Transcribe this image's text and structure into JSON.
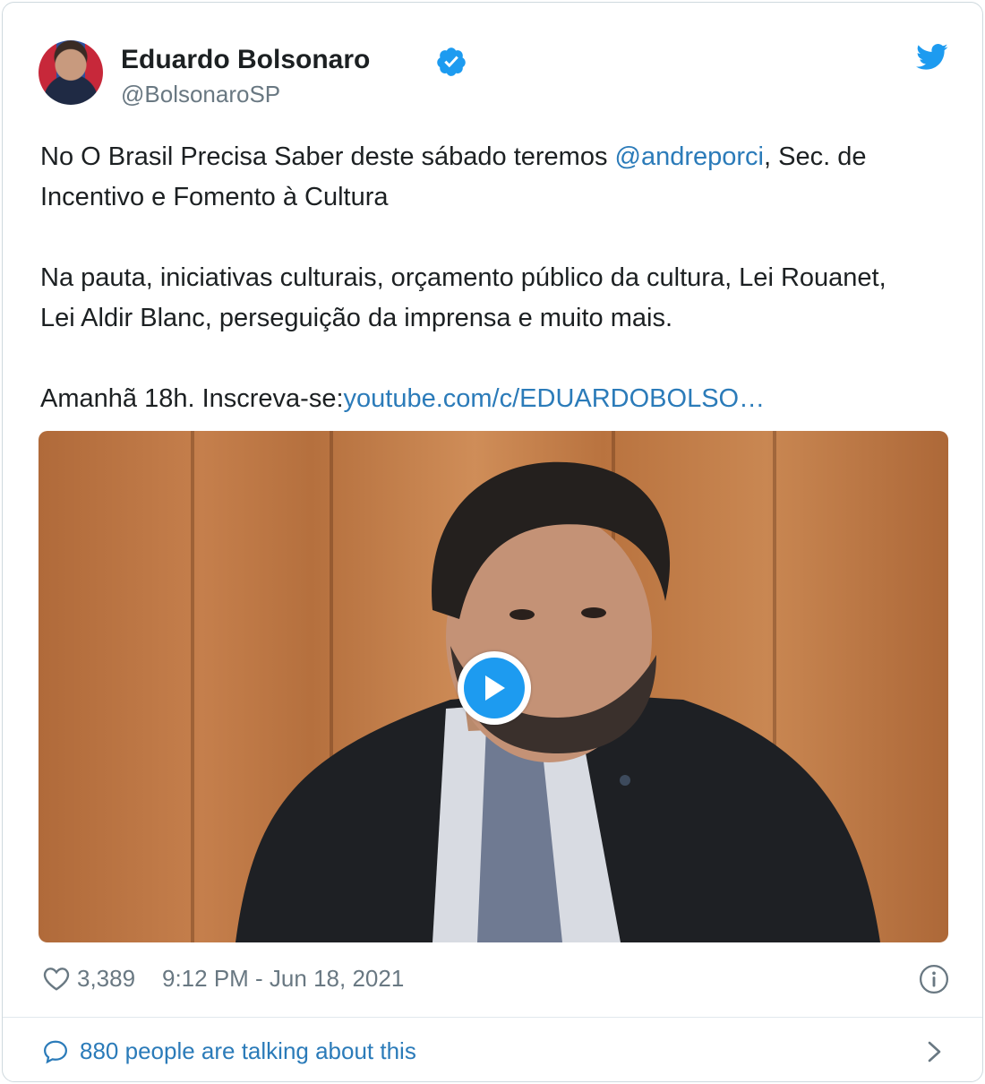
{
  "author": {
    "name": "Eduardo Bolsonaro",
    "handle": "@BolsonaroSP"
  },
  "tweet": {
    "p1_before": "No O Brasil Precisa Saber deste sábado teremos ",
    "p1_mention": "@andreporci",
    "p1_after": ", Sec. de",
    "p1_line2": "Incentivo e Fomento à Cultura",
    "p2_line1": "Na pauta, iniciativas culturais, orçamento público da cultura, Lei Rouanet,",
    "p2_line2": "Lei Aldir Blanc, perseguição da imprensa e muito mais.",
    "p3_text": "Amanhã 18h. Inscreva-se:",
    "p3_link": "youtube.com/c/EDUARDOBOLSO…"
  },
  "footer": {
    "likes": "3,389",
    "timestamp": "9:12 PM - Jun 18, 2021",
    "talking": "880 people are talking about this"
  },
  "colors": {
    "link": "#2b7bb9",
    "twitter_blue": "#1d9bf0",
    "muted": "#697882"
  },
  "icons": [
    "verified-badge-icon",
    "twitter-bird-icon",
    "play-icon",
    "heart-icon",
    "info-icon",
    "speech-bubble-icon",
    "chevron-right-icon"
  ]
}
